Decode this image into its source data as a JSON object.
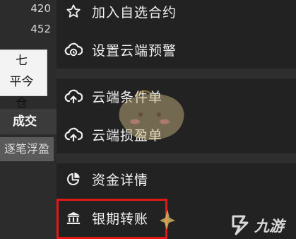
{
  "left_panel": {
    "values": [
      "420",
      "452"
    ],
    "close_button_line1": "平今",
    "close_button_line2": "仓",
    "close_button_prefix": "七",
    "deal_label": "成交",
    "float_label": "逐笔浮盈"
  },
  "menu": {
    "items": [
      {
        "label": "加入自选合约",
        "icon": "star-icon"
      },
      {
        "label": "设置云端预警",
        "icon": "cloud-alert-icon"
      },
      {
        "label": "云端条件单",
        "icon": "cloud-upload-icon"
      },
      {
        "label": "云端损盈单",
        "icon": "cloud-upload-icon"
      },
      {
        "label": "资金详情",
        "icon": "pie-chart-icon"
      },
      {
        "label": "银期转账",
        "icon": "bank-icon"
      }
    ]
  },
  "watermark": {
    "text": "九游"
  },
  "colors": {
    "menu_bg": "#222222",
    "separator": "#2e2e2e",
    "highlight": "#e01818",
    "text": "#f1f1f1"
  }
}
